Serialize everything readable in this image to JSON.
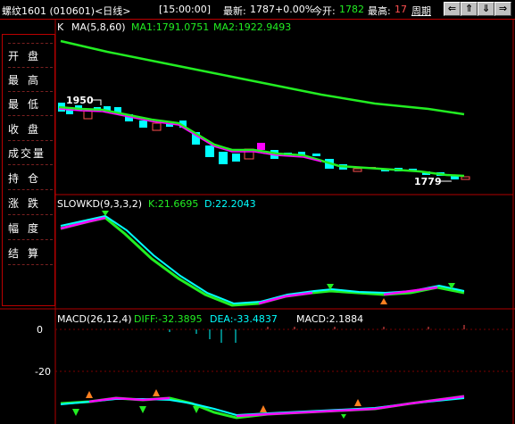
{
  "header": {
    "instrument": "螺纹1601 (010601)<日线>",
    "time": "[15:00:00]",
    "latest_label": "最新:",
    "latest_value": "1787",
    "change": "+0.00%",
    "open_label": "今开:",
    "open_value": "1782",
    "high_label": "最高:",
    "high_value": "17",
    "period_button": "周期"
  },
  "nav_icons": [
    "arrow-left-icon",
    "arrow-up-icon",
    "arrow-down-icon",
    "arrow-right-icon"
  ],
  "side_panel": {
    "items": [
      "开盘",
      "最高",
      "最低",
      "收盘",
      "成交量",
      "持仓",
      "涨跌",
      "幅度",
      "结算"
    ]
  },
  "main_chart": {
    "label": "K",
    "ma_title": "MA(5,8,60)",
    "ma1": "MA1:1791.0751",
    "ma2": "MA2:1922.9493",
    "high_marker": "1950",
    "low_marker": "1779"
  },
  "kd_panel": {
    "title": "SLOWKD(9,3,3,2)",
    "k": "K:21.6695",
    "d": "D:22.2043"
  },
  "macd_panel": {
    "title": "MACD(26,12,4)",
    "diff": "DIFF:-32.3895",
    "dea": "DEA:-33.4837",
    "macd": "MACD:2.1884",
    "ytick_0": "0",
    "ytick_neg20": "-20"
  },
  "colors": {
    "up": "#ff5050",
    "down": "#00ffff",
    "ma_green": "#22ee22",
    "magenta": "#ff00ff",
    "frame": "#b00000"
  }
}
